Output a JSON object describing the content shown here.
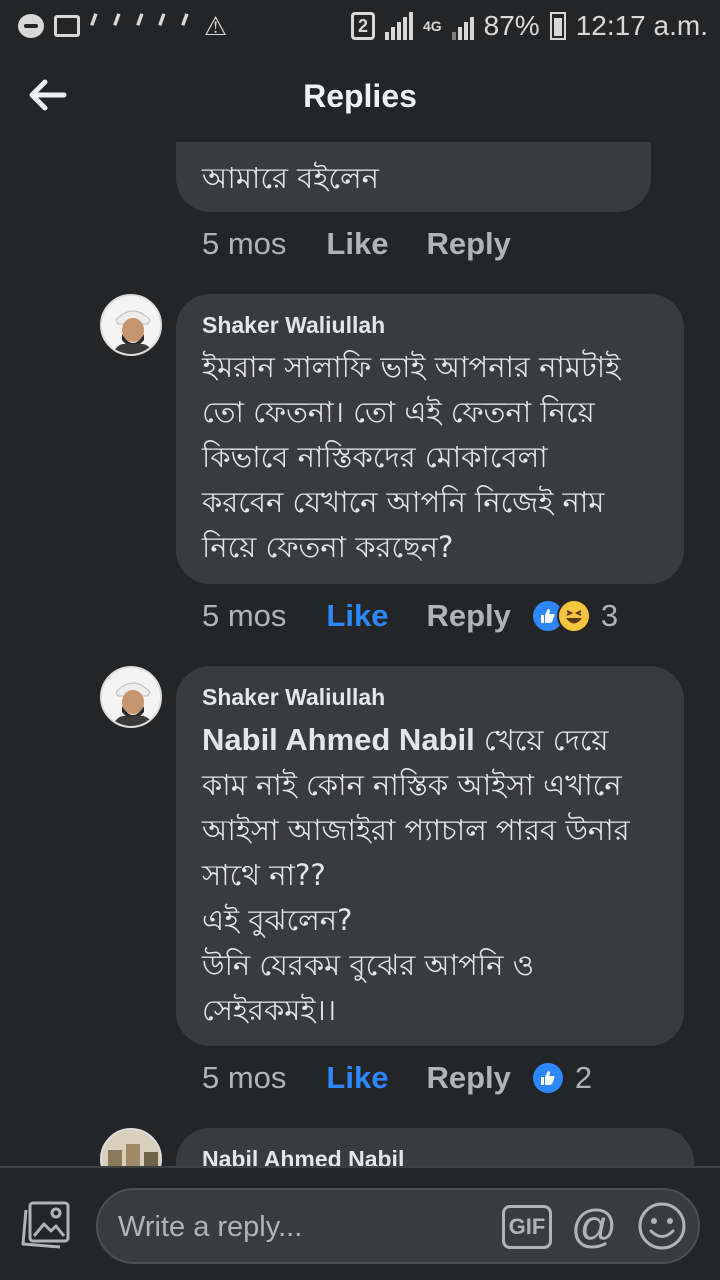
{
  "status_bar": {
    "sim_slot": "2",
    "network": "4G",
    "battery": "87%",
    "time": "12:17 a.m."
  },
  "header": {
    "title": "Replies"
  },
  "replies": [
    {
      "author": "",
      "text": "আমারে বইলেন",
      "time": "5 mos",
      "like_label": "Like",
      "reply_label": "Reply",
      "liked": false,
      "reaction_count": ""
    },
    {
      "author": "Shaker Waliullah",
      "text": "ইমরান সালাফি ভাই আপনার নামটাই\nতো ফেতনা। তো এই ফেতনা নিয়ে\nকিভাবে নাস্তিকদের মোকাবেলা\nকরবেন যেখানে আপনি নিজেই নাম\nনিয়ে ফেতনা করছেন?",
      "time": "5 mos",
      "like_label": "Like",
      "reply_label": "Reply",
      "liked": true,
      "reaction_count": "3"
    },
    {
      "author": "Shaker Waliullah",
      "mention": "Nabil Ahmed Nabil",
      "text_after_mention": " খেয়ে দেয়ে",
      "text": "কাম নাই কোন নাস্তিক আইসা এখানে\nআইসা আজাইরা প্যাচাল পারব উনার\nসাথে না??\nএই বুঝলেন?\nউনি যেরকম বুঝের আপনি ও\nসেইরকমই।।",
      "time": "5 mos",
      "like_label": "Like",
      "reply_label": "Reply",
      "liked": true,
      "reaction_count": "2"
    },
    {
      "author": "Nabil Ahmed Nabil"
    }
  ],
  "composer": {
    "placeholder": "Write a reply...",
    "gif_label": "GIF",
    "at_label": "@"
  },
  "colors": {
    "background": "#242526",
    "bubble": "#3a3b3c",
    "accent": "#2d88ff",
    "muted": "#b0b3b8"
  }
}
